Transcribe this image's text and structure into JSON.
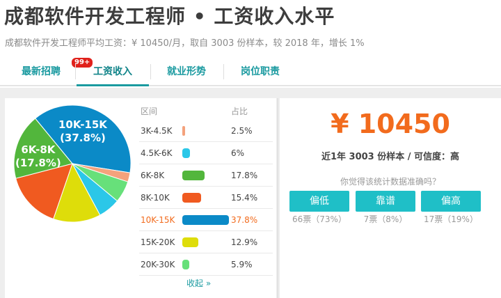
{
  "header": {
    "title": "成都软件开发工程师 • 工资收入水平",
    "subtitle": "成都软件开发工程师平均工资：¥ 10450/月，取自 3003 份样本，较 2018 年，增长 1%"
  },
  "tabs": [
    {
      "label": "最新招聘",
      "badge": "99+"
    },
    {
      "label": "工资收入",
      "active": true
    },
    {
      "label": "就业形势"
    },
    {
      "label": "岗位职责"
    }
  ],
  "table": {
    "col_range": "区间",
    "col_pct": "占比",
    "collapse_label": "收起 »"
  },
  "pie_labels": {
    "big": {
      "range": "10K-15K",
      "pct": "(37.8%)"
    },
    "mid": {
      "range": "6K-8K",
      "pct": "(17.8%)"
    }
  },
  "chart_data": {
    "type": "pie",
    "title": "",
    "slices": [
      {
        "label": "3K-4.5K",
        "display": "2.5%",
        "value": 2.5,
        "color": "#f4a27c"
      },
      {
        "label": "4.5K-6K",
        "display": "6%",
        "value": 6.0,
        "color": "#2bc7e8"
      },
      {
        "label": "6K-8K",
        "display": "17.8%",
        "value": 17.8,
        "color": "#52b63c"
      },
      {
        "label": "8K-10K",
        "display": "15.4%",
        "value": 15.4,
        "color": "#f05a20"
      },
      {
        "label": "10K-15K",
        "display": "37.8%",
        "value": 37.8,
        "color": "#0b8ac7"
      },
      {
        "label": "15K-20K",
        "display": "12.9%",
        "value": 12.9,
        "color": "#dedd0a"
      },
      {
        "label": "20K-30K",
        "display": "5.9%",
        "value": 5.9,
        "color": "#67e07a"
      }
    ],
    "highlight": "10K-15K"
  },
  "summary": {
    "salary": "¥ 10450",
    "meta": "近1年 3003 份样本 / 可信度：高",
    "question": "你觉得该统计数据准确吗？"
  },
  "votes": [
    {
      "label": "偏低",
      "count": "66票（73%）"
    },
    {
      "label": "靠谱",
      "count": "7票（8%）"
    },
    {
      "label": "偏高",
      "count": "17票（19%）"
    }
  ],
  "colors": {
    "accent": "#1a9aa0",
    "highlight": "#f26b1d",
    "button": "#1fbfc7"
  }
}
